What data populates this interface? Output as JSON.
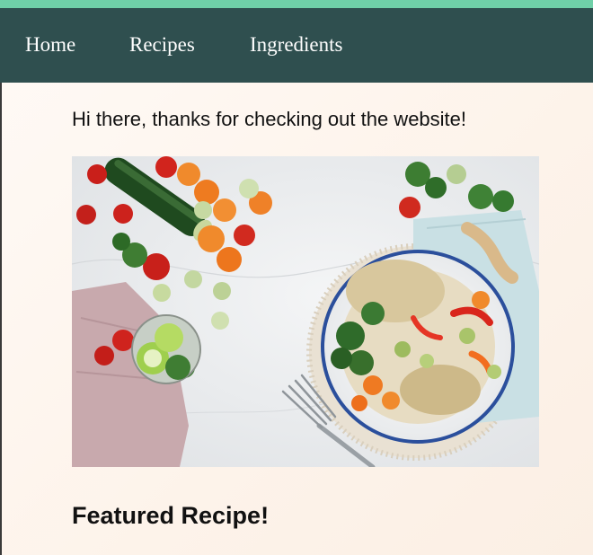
{
  "nav": {
    "items": [
      {
        "label": "Home"
      },
      {
        "label": "Recipes"
      },
      {
        "label": "Ingredients"
      }
    ]
  },
  "main": {
    "greeting": "Hi there, thanks for checking out the website!",
    "hero_image": {
      "alt": "Vegetables and a bowl of grain salad on a marble table"
    },
    "featured_heading": "Featured Recipe!"
  },
  "colors": {
    "accent": "#6fd0a8",
    "nav_bg": "#2f4f4f",
    "nav_text": "#ffffff",
    "page_bg": "#fdf5ee"
  }
}
